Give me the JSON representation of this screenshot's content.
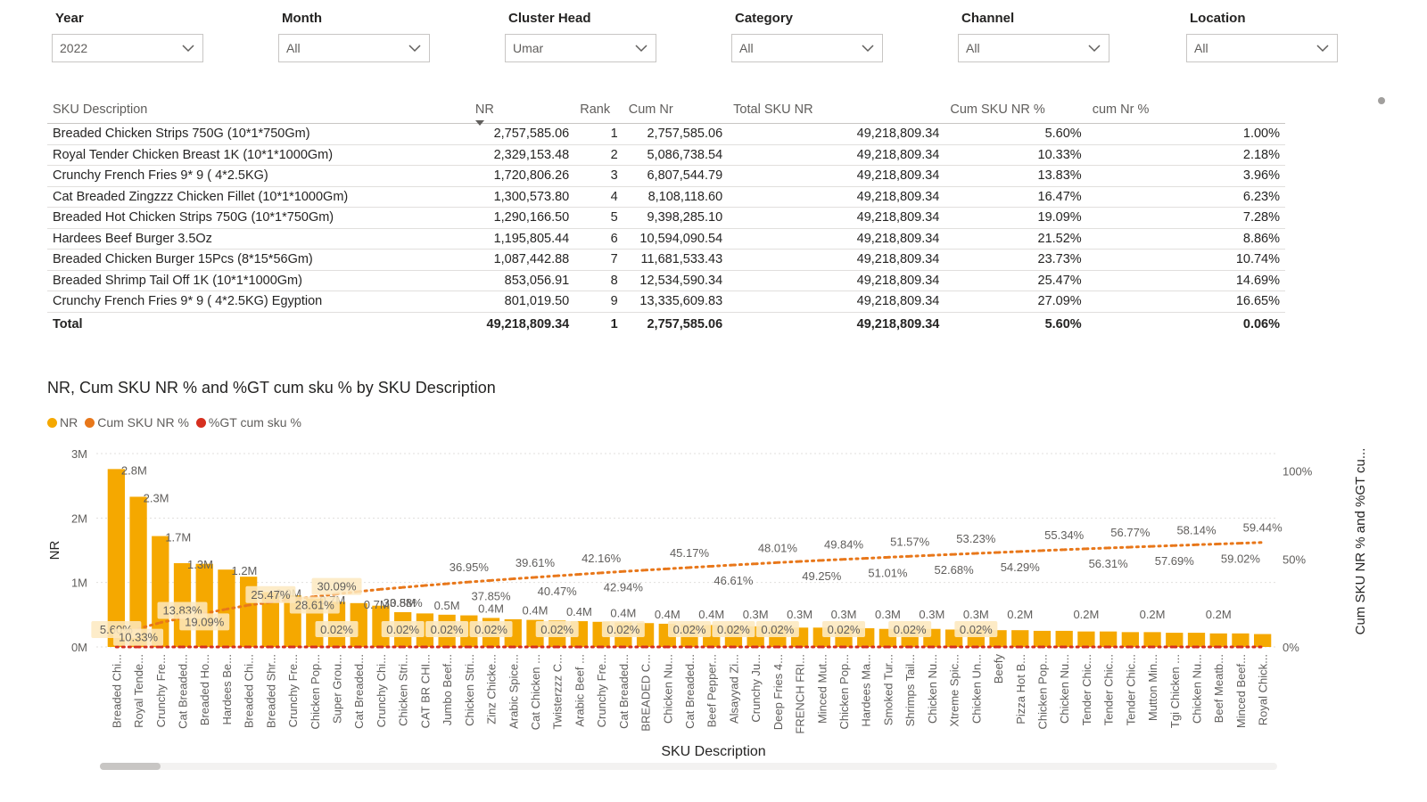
{
  "filters": [
    {
      "label": "Year",
      "value": "2022"
    },
    {
      "label": "Month",
      "value": "All"
    },
    {
      "label": "Cluster Head",
      "value": "Umar"
    },
    {
      "label": "Category",
      "value": "All"
    },
    {
      "label": "Channel",
      "value": "All"
    },
    {
      "label": "Location",
      "value": "All"
    }
  ],
  "table": {
    "headers": [
      "SKU Description",
      "NR",
      "Rank",
      "Cum Nr",
      "Total SKU NR",
      "Cum SKU NR %",
      "cum Nr %"
    ],
    "rows": [
      [
        "Breaded Chicken Strips 750G (10*1*750Gm)",
        "2,757,585.06",
        "1",
        "2,757,585.06",
        "49,218,809.34",
        "5.60%",
        "1.00%"
      ],
      [
        "Royal Tender Chicken Breast 1K (10*1*1000Gm)",
        "2,329,153.48",
        "2",
        "5,086,738.54",
        "49,218,809.34",
        "10.33%",
        "2.18%"
      ],
      [
        "Crunchy French Fries 9* 9 ( 4*2.5KG)",
        "1,720,806.26",
        "3",
        "6,807,544.79",
        "49,218,809.34",
        "13.83%",
        "3.96%"
      ],
      [
        "Cat Breaded Zingzzz Chicken Fillet (10*1*1000Gm)",
        "1,300,573.80",
        "4",
        "8,108,118.60",
        "49,218,809.34",
        "16.47%",
        "6.23%"
      ],
      [
        "Breaded Hot Chicken Strips 750G (10*1*750Gm)",
        "1,290,166.50",
        "5",
        "9,398,285.10",
        "49,218,809.34",
        "19.09%",
        "7.28%"
      ],
      [
        "Hardees Beef Burger 3.5Oz",
        "1,195,805.44",
        "6",
        "10,594,090.54",
        "49,218,809.34",
        "21.52%",
        "8.86%"
      ],
      [
        "Breaded Chicken Burger 15Pcs (8*15*56Gm)",
        "1,087,442.88",
        "7",
        "11,681,533.43",
        "49,218,809.34",
        "23.73%",
        "10.74%"
      ],
      [
        "Breaded Shrimp Tail Off 1K (10*1*1000Gm)",
        "853,056.91",
        "8",
        "12,534,590.34",
        "49,218,809.34",
        "25.47%",
        "14.69%"
      ],
      [
        "Crunchy French Fries 9* 9 ( 4*2.5KG) Egyption",
        "801,019.50",
        "9",
        "13,335,609.83",
        "49,218,809.34",
        "27.09%",
        "16.65%"
      ]
    ],
    "total": [
      "Total",
      "49,218,809.34",
      "1",
      "2,757,585.06",
      "49,218,809.34",
      "5.60%",
      "0.06%"
    ]
  },
  "chart_data": {
    "type": "bar",
    "title": "NR, Cum SKU NR % and %GT cum sku % by SKU Description",
    "legend": [
      "NR",
      "Cum SKU NR %",
      "%GT cum sku %"
    ],
    "legend_position": "top-left",
    "xlabel": "SKU Description",
    "ylabel": "NR",
    "y2label": "Cum SKU NR % and %GT cu...",
    "ylim": [
      0,
      3000000
    ],
    "y_ticks": [
      "0M",
      "1M",
      "2M",
      "3M"
    ],
    "y2_ticks": [
      "0%",
      "50%",
      "100%"
    ],
    "y2lim": [
      0,
      110
    ],
    "grid": true,
    "colors": {
      "nr": "#f5a800",
      "cum": "#e8771a",
      "gt": "#d62f1f"
    },
    "categories": [
      "Breaded Chi...",
      "Royal Tende...",
      "Crunchy Fre...",
      "Cat Breaded...",
      "Breaded Ho...",
      "Hardees Be...",
      "Breaded Chi...",
      "Breaded Shr...",
      "Crunchy Fre...",
      "Chicken Pop...",
      "Super Grou...",
      "Cat Breaded...",
      "Crunchy Chi...",
      "Chicken Stri...",
      "CAT BR CHI...",
      "Jumbo Beef...",
      "Chicken Stri...",
      "Zinz Chicke...",
      "Arabic Spice...",
      "Cat Chicken ...",
      "Twisterzzz C...",
      "Arabic Beef ...",
      "Crunchy Fre...",
      "Cat Breaded...",
      "BREADED C...",
      "Chicken Nu...",
      "Cat Breaded...",
      "Beef Pepper...",
      "Alsayyad Zi...",
      "Crunchy Ju...",
      "Deep Fries 4...",
      "FRENCH FRI...",
      "Minced Mut...",
      "Chicken Pop...",
      "Hardees Ma...",
      "Smoked Tur...",
      "Shrimps Tail...",
      "Chicken Nu...",
      "Xtreme Spic...",
      "Chicken Un...",
      "Beefy",
      "Pizza Hot B...",
      "Chicken Pop...",
      "Chicken Nu...",
      "Tender Chic...",
      "Tender Chic...",
      "Tender Chic...",
      "Mutton Min...",
      "Tgi Chicken ...",
      "Chicken Nu...",
      "Beef Meatb...",
      "Minced Beef...",
      "Royal Chick..."
    ],
    "series": [
      {
        "name": "NR",
        "values": [
          2760000,
          2330000,
          1720000,
          1300000,
          1290000,
          1200000,
          1090000,
          850000,
          800000,
          750000,
          700000,
          680000,
          640000,
          540000,
          520000,
          500000,
          490000,
          450000,
          430000,
          420000,
          410000,
          400000,
          390000,
          380000,
          370000,
          360000,
          350000,
          340000,
          330000,
          320000,
          310000,
          300000,
          300000,
          290000,
          290000,
          280000,
          280000,
          280000,
          270000,
          270000,
          260000,
          260000,
          250000,
          250000,
          240000,
          240000,
          230000,
          230000,
          220000,
          220000,
          210000,
          210000,
          200000
        ]
      },
      {
        "name": "Cum SKU NR %",
        "values": [
          5.6,
          10.33,
          13.83,
          16.47,
          19.09,
          21.52,
          23.73,
          25.47,
          27.09,
          28.61,
          30.09,
          31.5,
          32.8,
          33.88,
          34.95,
          35.95,
          36.95,
          37.85,
          38.75,
          39.61,
          40.47,
          41.3,
          42.16,
          42.94,
          43.7,
          44.45,
          45.17,
          45.9,
          46.61,
          47.3,
          48.01,
          48.64,
          49.25,
          49.84,
          50.42,
          51.01,
          51.57,
          52.13,
          52.68,
          53.23,
          53.76,
          54.29,
          54.81,
          55.34,
          55.83,
          56.31,
          56.77,
          57.24,
          57.69,
          58.14,
          58.58,
          59.02,
          59.44
        ]
      },
      {
        "name": "%GT cum sku %",
        "values": [
          0.02,
          0.02,
          0.02,
          0.02,
          0.02,
          0.02,
          0.02,
          0.02,
          0.02,
          0.02,
          0.02,
          0.02,
          0.02,
          0.02,
          0.02,
          0.02,
          0.02,
          0.02,
          0.02,
          0.02,
          0.02,
          0.02,
          0.02,
          0.02,
          0.02,
          0.02,
          0.02,
          0.02,
          0.02,
          0.02,
          0.02,
          0.02,
          0.02,
          0.02,
          0.02,
          0.02,
          0.02,
          0.02,
          0.02,
          0.02,
          0.02,
          0.02,
          0.02,
          0.02,
          0.02,
          0.02,
          0.02,
          0.02,
          0.02,
          0.02,
          0.02,
          0.02,
          0.02
        ]
      }
    ],
    "bar_labels": [
      "2.8M",
      "2.3M",
      "1.7M",
      "1.3M",
      "1.2M",
      "0.9M",
      "0.7M",
      "0.7M",
      "0.5M",
      "0.5M",
      "0.4M",
      "0.4M",
      "0.4M",
      "0.4M",
      "0.4M",
      "0.4M",
      "0.3M",
      "0.3M",
      "0.3M",
      "0.3M",
      "0.3M",
      "0.3M",
      "0.2M",
      "0.2M",
      "0.2M",
      "0.2M"
    ],
    "cum_labels": [
      "5.60%",
      "10.33%",
      "13.83%",
      "19.09%",
      "25.47%",
      "28.61%",
      "30.09%",
      "33.88%",
      "36.95%",
      "37.85%",
      "39.61%",
      "40.47%",
      "42.16%",
      "42.94%",
      "45.17%",
      "46.61%",
      "48.01%",
      "49.25%",
      "49.84%",
      "51.01%",
      "51.57%",
      "52.68%",
      "53.23%",
      "54.29%",
      "55.34%",
      "56.31%",
      "56.77%",
      "57.69%",
      "58.14%",
      "59.02%",
      "59.44%"
    ],
    "gt_labels": [
      "0.02%",
      "0.02%",
      "0.02%",
      "0.02%",
      "0.02%",
      "0.02%",
      "0.02%",
      "0.02%",
      "0.02%",
      "0.02%",
      "0.02%",
      "0.02%"
    ]
  }
}
